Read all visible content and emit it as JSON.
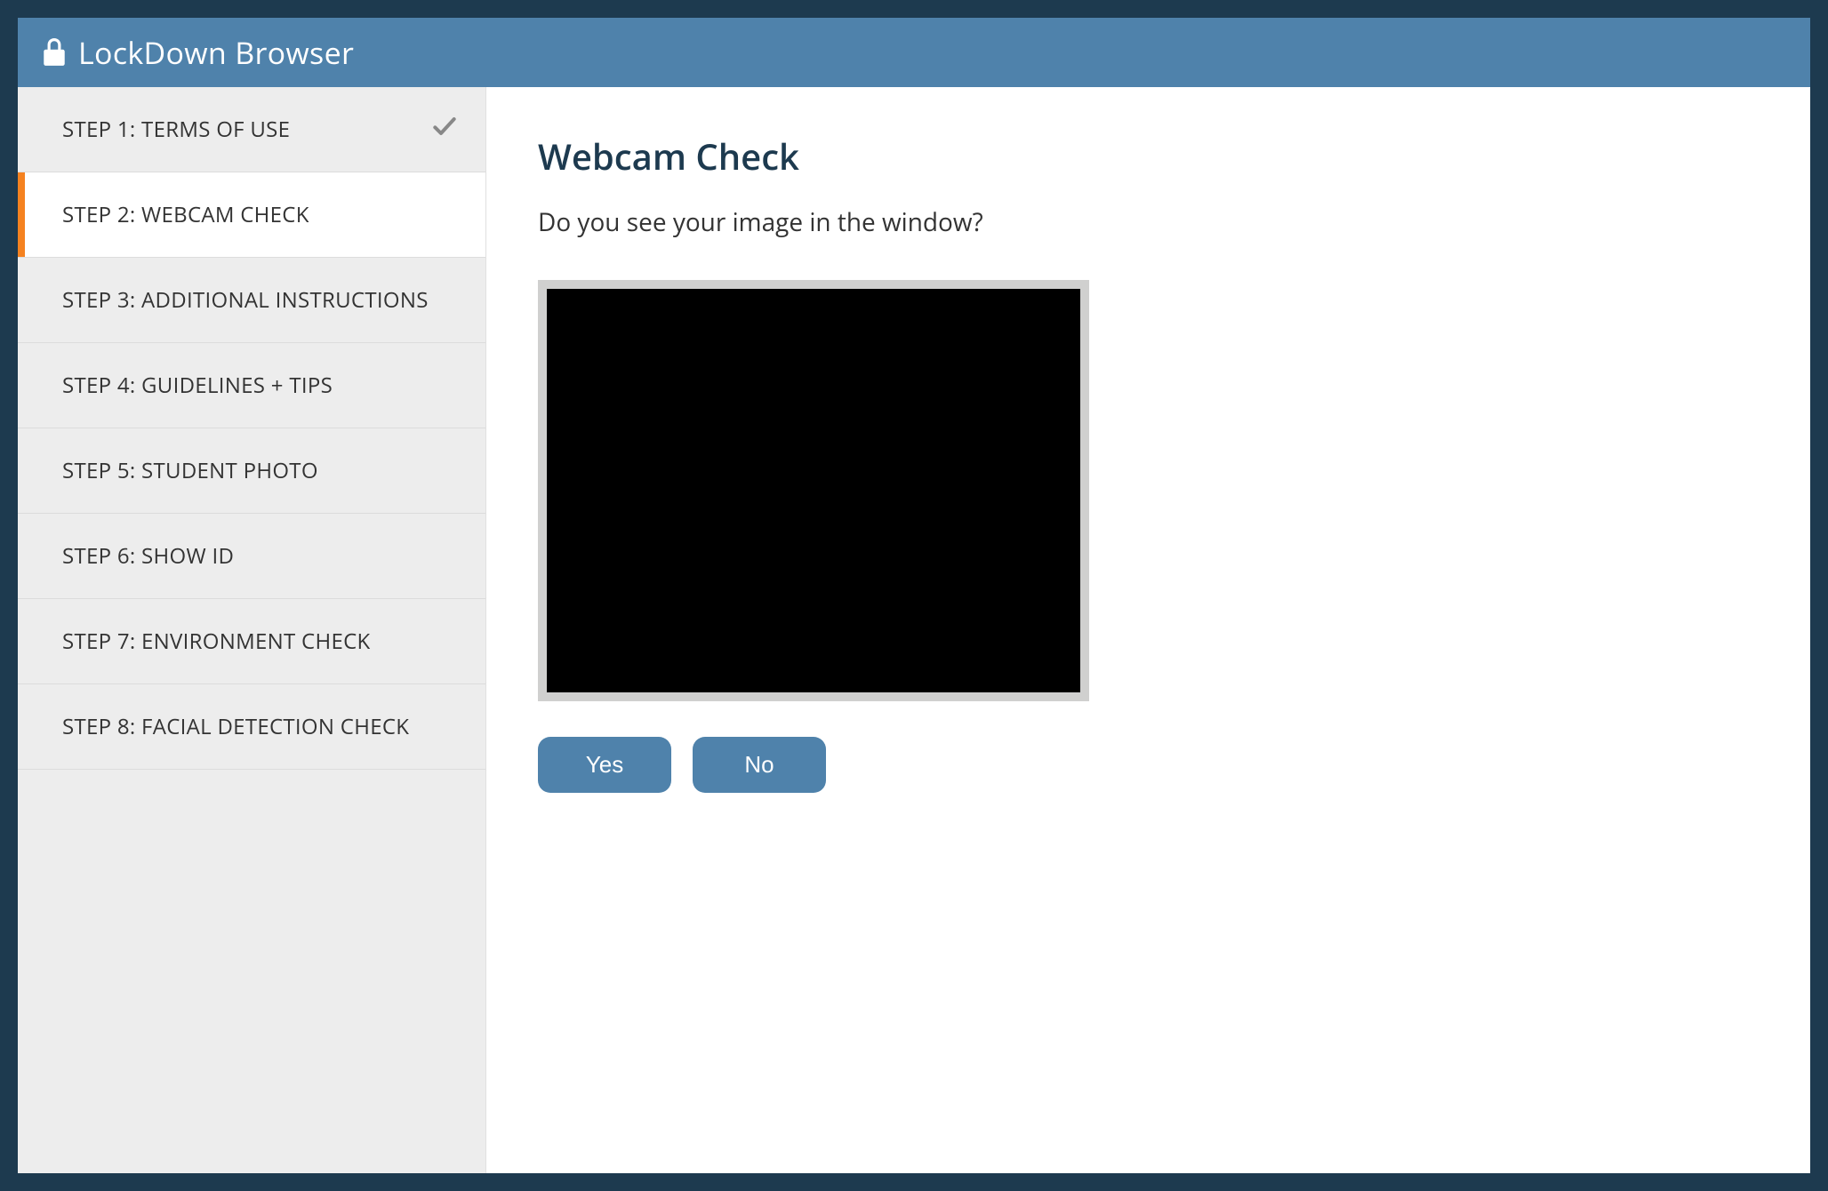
{
  "header": {
    "title": "LockDown Browser"
  },
  "sidebar": {
    "steps": [
      {
        "label": "STEP 1: TERMS OF USE",
        "completed": true,
        "active": false
      },
      {
        "label": "STEP 2: WEBCAM CHECK",
        "completed": false,
        "active": true
      },
      {
        "label": "STEP 3: ADDITIONAL INSTRUCTIONS",
        "completed": false,
        "active": false
      },
      {
        "label": "STEP 4: GUIDELINES + TIPS",
        "completed": false,
        "active": false
      },
      {
        "label": "STEP 5: STUDENT PHOTO",
        "completed": false,
        "active": false
      },
      {
        "label": "STEP 6: SHOW ID",
        "completed": false,
        "active": false
      },
      {
        "label": "STEP 7: ENVIRONMENT CHECK",
        "completed": false,
        "active": false
      },
      {
        "label": "STEP 8: FACIAL DETECTION CHECK",
        "completed": false,
        "active": false
      }
    ]
  },
  "main": {
    "heading": "Webcam Check",
    "question": "Do you see your image in the window?",
    "buttons": {
      "yes": "Yes",
      "no": "No"
    }
  }
}
